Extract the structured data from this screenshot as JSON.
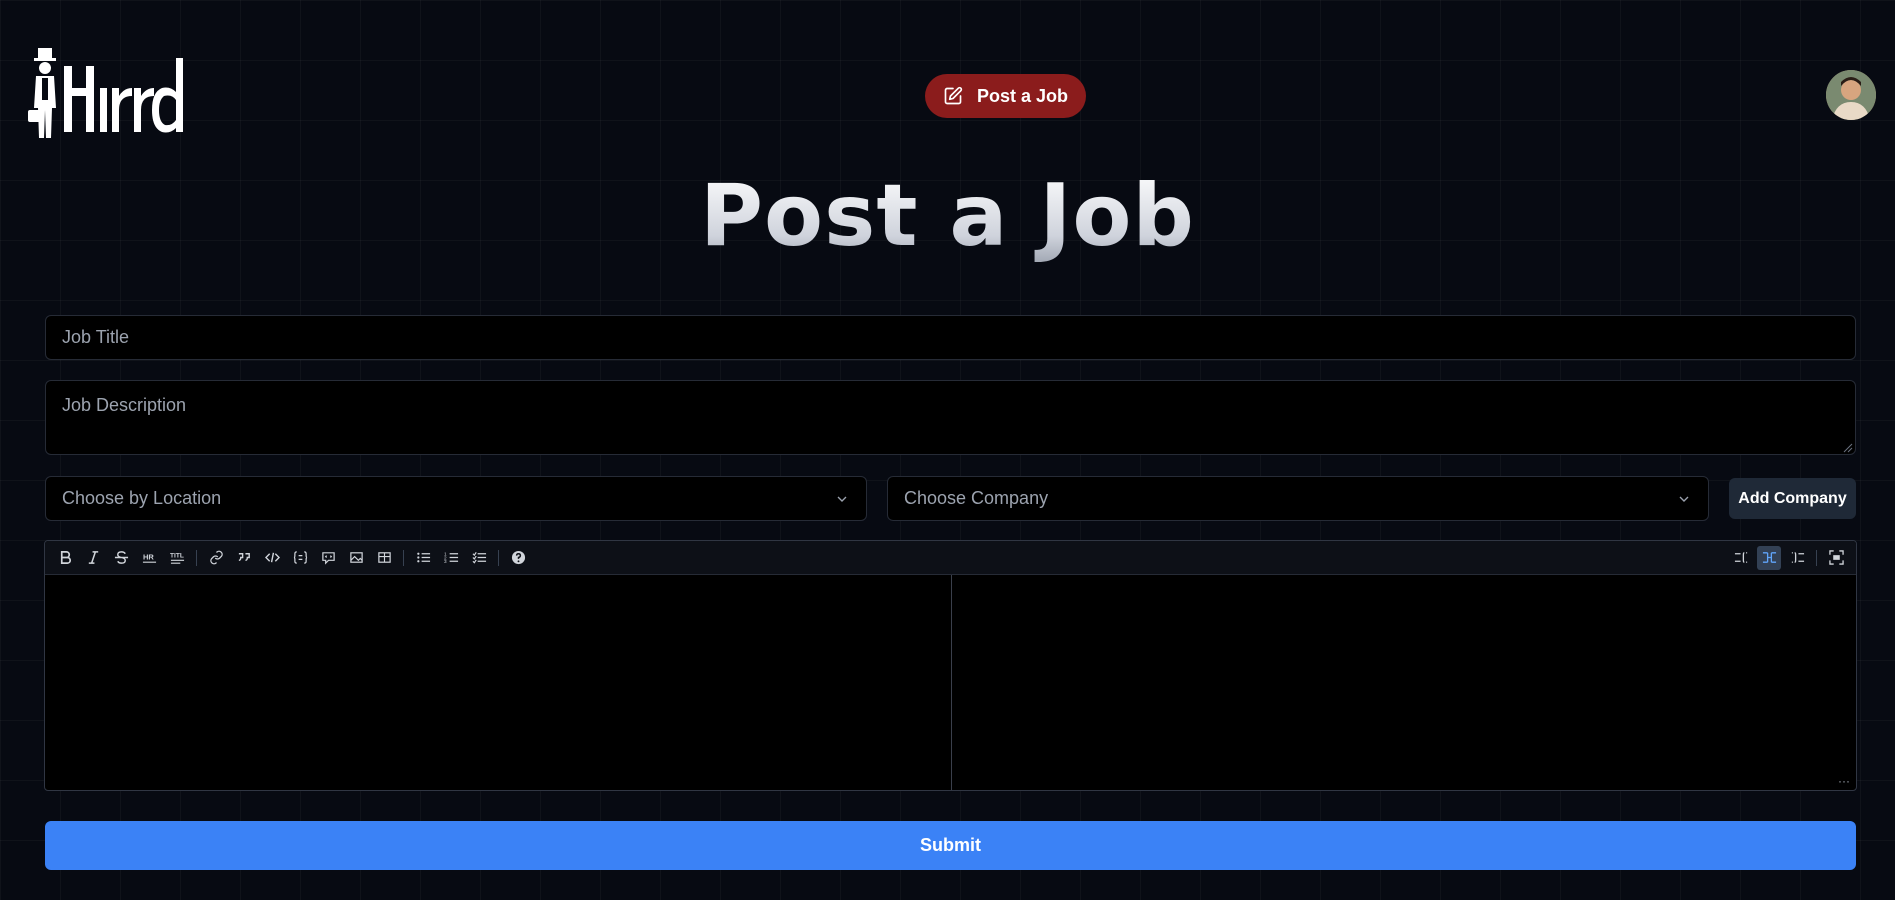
{
  "header": {
    "logo_text": "Hirrd",
    "post_job_button": "Post a Job",
    "avatar_alt": "user avatar"
  },
  "main": {
    "title": "Post a Job",
    "job_title_placeholder": "Job Title",
    "job_description_placeholder": "Job Description",
    "location_select": "Choose by Location",
    "company_select": "Choose Company",
    "add_company_button": "Add Company",
    "submit_button": "Submit"
  },
  "editor": {
    "toolbar_left": [
      "bold-icon",
      "italic-icon",
      "strikethrough-icon",
      "hr-icon",
      "title-icon",
      "link-icon",
      "quote-icon",
      "code-icon",
      "code-block-icon",
      "comment-icon",
      "image-icon",
      "table-icon",
      "unordered-list-icon",
      "ordered-list-icon",
      "checked-list-icon",
      "help-icon"
    ],
    "toolbar_right": [
      "edit-mode-icon",
      "live-mode-icon",
      "preview-mode-icon",
      "fullscreen-icon"
    ],
    "active_mode": "live",
    "content": ""
  },
  "colors": {
    "post_button_bg": "#8b1c1c",
    "submit_bg": "#3b82f6",
    "background": "#070a12"
  }
}
